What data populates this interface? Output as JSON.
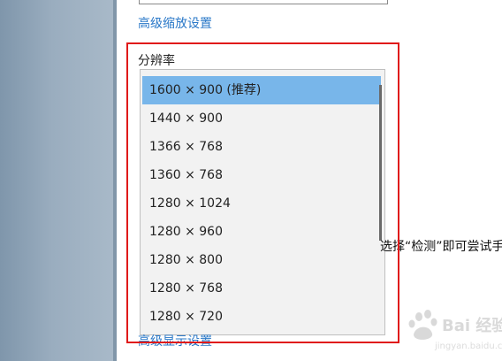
{
  "links": {
    "advanced_scale": "高级缩放设置",
    "advanced_display": "高级显示设置"
  },
  "resolution": {
    "label": "分辨率",
    "options": [
      "1600 × 900 (推荐)",
      "1440 × 900",
      "1366 × 768",
      "1360 × 768",
      "1280 × 1024",
      "1280 × 960",
      "1280 × 800",
      "1280 × 768",
      "1280 × 720"
    ],
    "selected": "1600 × 900 (推荐)"
  },
  "side_text": "选择“检测”即可尝试手",
  "watermark": {
    "site": "Bai 经验",
    "url": "jingyan.baidu.com"
  },
  "colors": {
    "link": "#2a78c8",
    "selected_row": "#78b6ea",
    "highlight_frame": "#e01a1a",
    "sidebar": "#9aadbf"
  }
}
